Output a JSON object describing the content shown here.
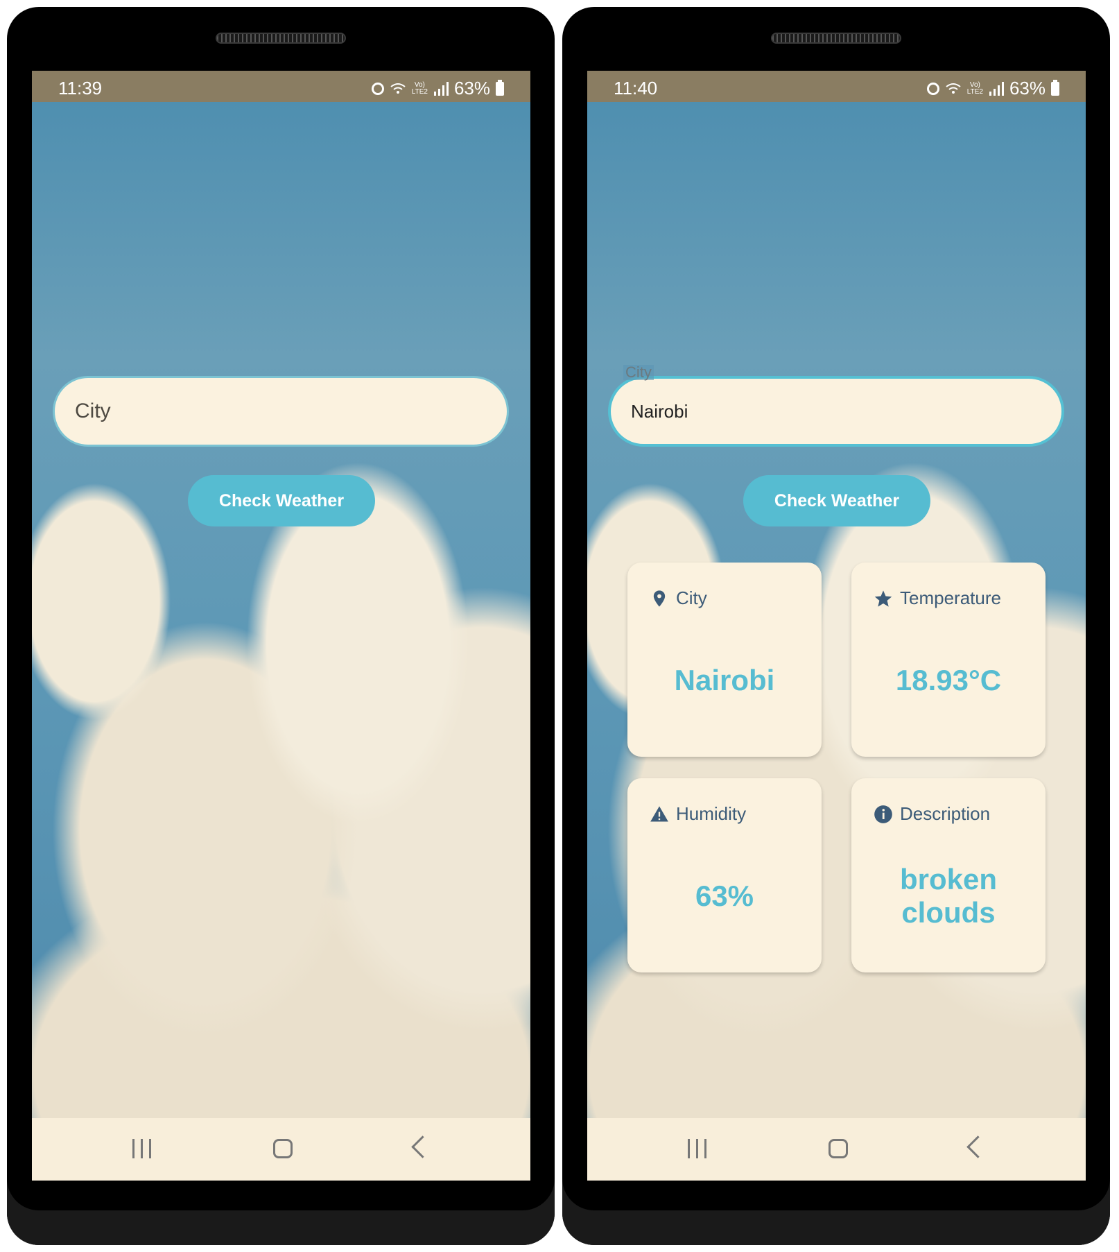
{
  "left_screen": {
    "status_time": "11:39",
    "battery": "63%",
    "city_input": {
      "placeholder": "City",
      "value": ""
    },
    "check_button": "Check Weather"
  },
  "right_screen": {
    "status_time": "11:40",
    "battery": "63%",
    "city_input": {
      "label": "City",
      "value": "Nairobi"
    },
    "check_button": "Check Weather",
    "cards": [
      {
        "label": "City",
        "icon": "location-pin-icon",
        "value": "Nairobi"
      },
      {
        "label": "Temperature",
        "icon": "star-icon",
        "value": "18.93°C"
      },
      {
        "label": "Humidity",
        "icon": "warning-icon",
        "value": "63%"
      },
      {
        "label": "Description",
        "icon": "info-icon",
        "value": "broken clouds"
      }
    ]
  },
  "colors": {
    "accent": "#56bcd1",
    "card_background": "#fbf2df",
    "card_label": "#3c5b78",
    "statusbar": "#8a7d62"
  }
}
